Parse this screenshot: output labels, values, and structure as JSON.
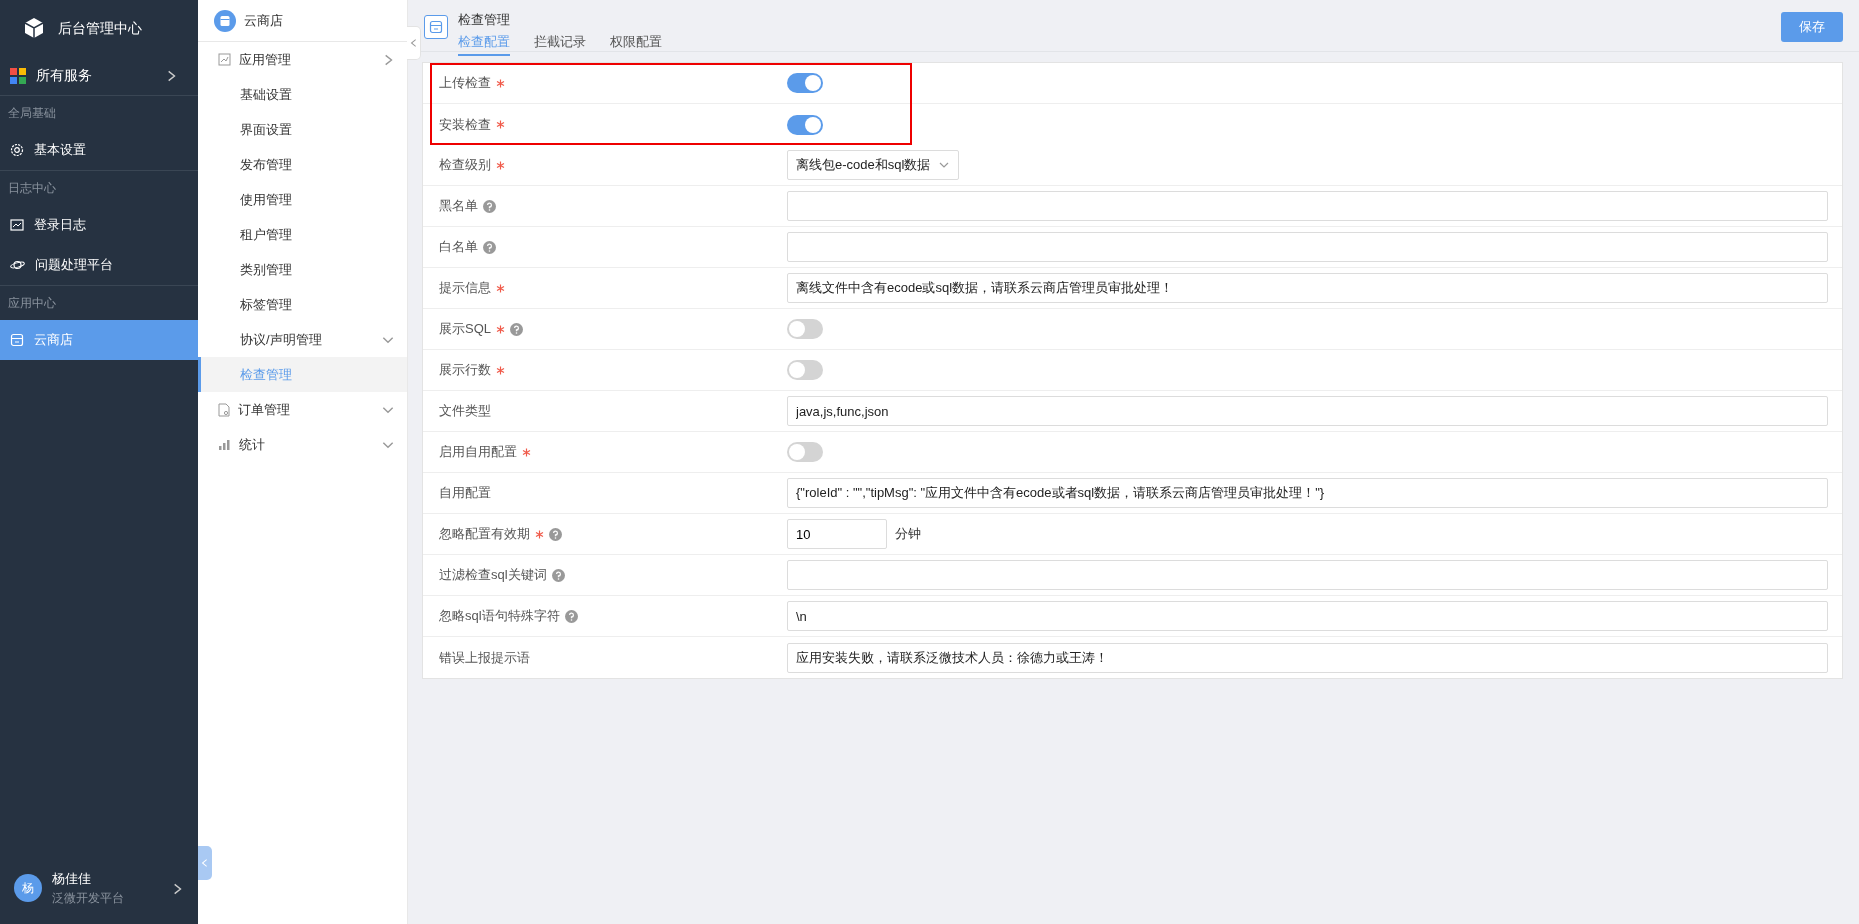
{
  "app": {
    "title": "后台管理中心"
  },
  "nav": {
    "all_services": "所有服务",
    "sections": [
      {
        "header": "全局基础",
        "items": [
          {
            "label": "基本设置",
            "selected": false
          }
        ]
      },
      {
        "header": "日志中心",
        "items": [
          {
            "label": "登录日志",
            "selected": false
          },
          {
            "label": "问题处理平台",
            "selected": false
          }
        ]
      },
      {
        "header": "应用中心",
        "items": [
          {
            "label": "云商店",
            "selected": true
          }
        ]
      }
    ]
  },
  "user": {
    "avatar": "杨",
    "name": "杨佳佳",
    "org": "泛微开发平台"
  },
  "submenu": {
    "title": "云商店",
    "items": [
      {
        "label": "应用管理",
        "expanded": true,
        "children": [
          {
            "label": "基础设置",
            "selected": false
          },
          {
            "label": "界面设置",
            "selected": false
          },
          {
            "label": "发布管理",
            "selected": false
          },
          {
            "label": "使用管理",
            "selected": false
          },
          {
            "label": "租户管理",
            "selected": false
          },
          {
            "label": "类别管理",
            "selected": false
          },
          {
            "label": "标签管理",
            "selected": false
          },
          {
            "label": "协议/声明管理",
            "selected": false,
            "expanded": false
          },
          {
            "label": "检查管理",
            "selected": true
          }
        ]
      },
      {
        "label": "订单管理",
        "expanded": false
      },
      {
        "label": "统计",
        "expanded": false
      }
    ]
  },
  "page": {
    "title": "检查管理",
    "tabs": [
      {
        "label": "检查配置",
        "selected": true
      },
      {
        "label": "拦截记录",
        "selected": false
      },
      {
        "label": "权限配置",
        "selected": false
      }
    ],
    "save_button": "保存"
  },
  "form": {
    "rows": [
      {
        "label": "上传检查",
        "required": true,
        "help": false,
        "kind": "toggle",
        "on": true,
        "highlighted": true
      },
      {
        "label": "安装检查",
        "required": true,
        "help": false,
        "kind": "toggle",
        "on": true,
        "highlighted": true
      },
      {
        "label": "检查级别",
        "required": true,
        "help": false,
        "kind": "select",
        "value": "离线包e-code和sql数据",
        "highlighted": false
      },
      {
        "label": "黑名单",
        "required": false,
        "help": true,
        "kind": "input",
        "value": "",
        "highlighted": false
      },
      {
        "label": "白名单",
        "required": false,
        "help": true,
        "kind": "input",
        "value": "",
        "highlighted": false
      },
      {
        "label": "提示信息",
        "required": true,
        "help": false,
        "kind": "input",
        "value": "离线文件中含有ecode或sql数据，请联系云商店管理员审批处理！",
        "highlighted": false
      },
      {
        "label": "展示SQL",
        "required": true,
        "help": true,
        "kind": "toggle",
        "on": false,
        "highlighted": false
      },
      {
        "label": "展示行数",
        "required": true,
        "help": false,
        "kind": "toggle",
        "on": false,
        "highlighted": false
      },
      {
        "label": "文件类型",
        "required": false,
        "help": false,
        "kind": "input",
        "value": "java,js,func,json",
        "highlighted": false
      },
      {
        "label": "启用自用配置",
        "required": true,
        "help": false,
        "kind": "toggle",
        "on": false,
        "highlighted": false
      },
      {
        "label": "自用配置",
        "required": false,
        "help": false,
        "kind": "input",
        "value": "{\"roleId\" : \"\",\"tipMsg\": \"应用文件中含有ecode或者sql数据，请联系云商店管理员审批处理！\"}",
        "highlighted": false
      },
      {
        "label": "忽略配置有效期",
        "required": true,
        "help": true,
        "kind": "number",
        "value": "10",
        "unit": "分钟",
        "highlighted": false
      },
      {
        "label": "过滤检查sql关键词",
        "required": false,
        "help": true,
        "kind": "input",
        "value": "",
        "highlighted": false
      },
      {
        "label": "忽略sql语句特殊字符",
        "required": false,
        "help": true,
        "kind": "input",
        "value": "\\n",
        "highlighted": false
      },
      {
        "label": "错误上报提示语",
        "required": false,
        "help": false,
        "kind": "input",
        "value": "应用安装失败，请联系泛微技术人员：徐德力或王涛！",
        "highlighted": false
      }
    ]
  }
}
